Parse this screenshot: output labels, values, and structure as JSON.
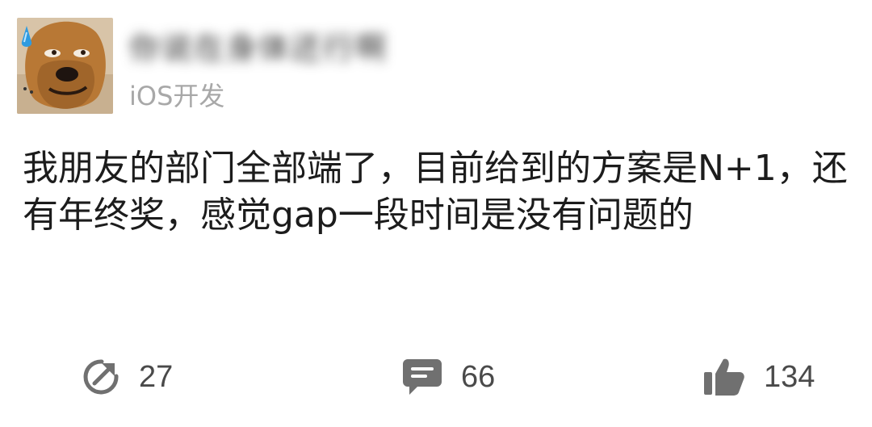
{
  "post": {
    "author": {
      "name": "你说在身体还行啊",
      "role": "iOS开发",
      "avatar_icon": "dog-avatar-with-sweat-drop"
    },
    "content": "我朋友的部门全部端了，目前给到的方案是N+1，还有年终奖，感觉gap一段时间是没有问题的"
  },
  "actions": {
    "share": {
      "icon": "share-icon",
      "count": "27"
    },
    "comment": {
      "icon": "comment-icon",
      "count": "66"
    },
    "like": {
      "icon": "thumbs-up-icon",
      "count": "134"
    }
  },
  "colors": {
    "text": "#1c1c1c",
    "secondary_text": "#a8a8a8",
    "icon": "#707070"
  }
}
